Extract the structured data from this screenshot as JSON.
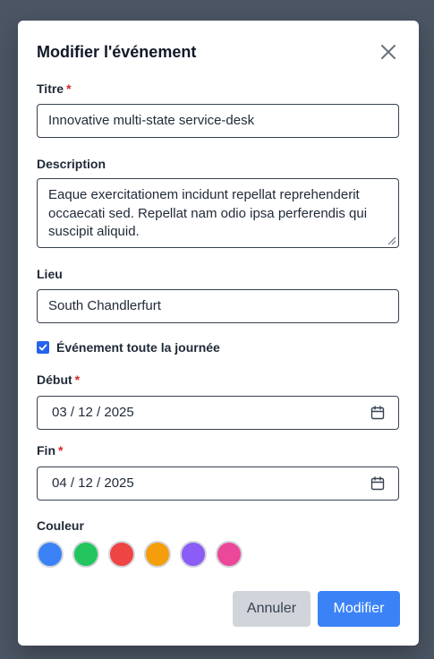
{
  "modal": {
    "title": "Modifier l'événement",
    "close_icon": "close-icon"
  },
  "form": {
    "title": {
      "label": "Titre",
      "required_mark": "*",
      "value": "Innovative multi-state service-desk"
    },
    "description": {
      "label": "Description",
      "value": "Eaque exercitationem incidunt repellat reprehenderit occaecati sed. Repellat nam odio ipsa perferendis qui suscipit aliquid."
    },
    "location": {
      "label": "Lieu",
      "value": "South Chandlerfurt"
    },
    "all_day": {
      "label": "Événement toute la journée",
      "checked": true
    },
    "start": {
      "label": "Début",
      "required_mark": "*",
      "value": "03 / 12 / 2025",
      "icon": "calendar-icon"
    },
    "end": {
      "label": "Fin",
      "required_mark": "*",
      "value": "04 / 12 / 2025",
      "icon": "calendar-icon"
    },
    "color": {
      "label": "Couleur",
      "options": [
        "#3b82f6",
        "#22c55e",
        "#ef4444",
        "#f59e0b",
        "#8b5cf6",
        "#ec4899"
      ]
    }
  },
  "actions": {
    "cancel_label": "Annuler",
    "save_label": "Modifier"
  },
  "colors": {
    "overlay": "#4b5563",
    "primary": "#3b82f6",
    "required": "#dc2626"
  }
}
